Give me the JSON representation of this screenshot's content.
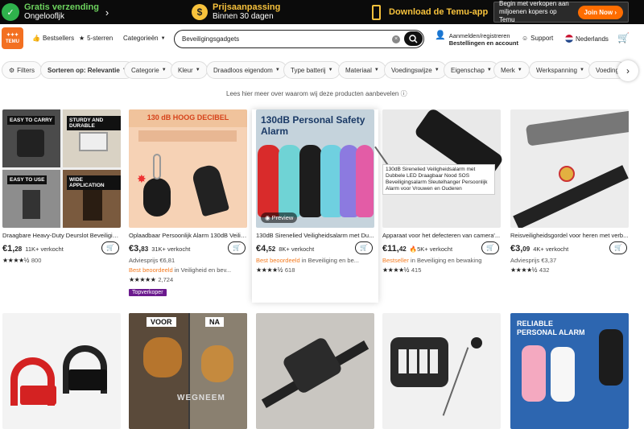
{
  "topbar": {
    "shipping_title": "Gratis verzending",
    "shipping_sub": "Ongeloofljk",
    "price_title": "Prijsaanpassing",
    "price_sub": "Binnen 30 dagen",
    "app": "Download de Temu-app",
    "seller_promo": "Begin met verkopen aan miljoenen kopers op Temu",
    "join": "Join Now"
  },
  "header": {
    "logo": "TEMU",
    "bestsellers": "Bestsellers",
    "five_star": "5-sterren",
    "categories": "Categorieën",
    "search_value": "Beveiligingsgadgets",
    "login_line1": "Aanmelden/registreren",
    "login_line2": "Bestellingen en account",
    "support": "Support",
    "language": "Nederlands"
  },
  "filters": [
    "Filters",
    "Sorteren op: Relevantie",
    "Categorie",
    "Kleur",
    "Draadloos eigendom",
    "Type batterij",
    "Materiaal",
    "Voedingswijze",
    "Eigenschap",
    "Merk",
    "Werkspanning",
    "Voeding"
  ],
  "note": "Lees hier meer over waarom wij deze producten aanbevelen",
  "products": [
    {
      "title": "Draagbare Heavy-Duty Deurslot Beveiligin...",
      "price_main": "€1,",
      "price_cents": "28",
      "sold": "11K+ verkocht",
      "rating_count": "800",
      "labels": [
        "EASY TO CARRY",
        "STURDY AND DURABLE",
        "EASY TO USE",
        "WIDE APPLICATION"
      ]
    },
    {
      "title": "Oplaadbaar Persoonlijk Alarm 130dB Veilig...",
      "price_main": "€3,",
      "price_cents": "83",
      "sold": "31K+ verkocht",
      "extra": "Adviesprijs €6,81",
      "best": "Best beoordeeld",
      "best_rest": "in Veiligheid en bev...",
      "rating_count": "2,724",
      "badge": "Topverkoper",
      "headline": "130 dB HOOG DECIBEL"
    },
    {
      "title": "130dB Sirenelied Veiligheidsalarm met Du...",
      "price_main": "€4,",
      "price_cents": "52",
      "sold": "8K+ verkocht",
      "best": "Best beoordeeld",
      "best_rest": "in Beveiliging en be...",
      "rating_count": "618",
      "headline": "130dB Personal Safety Alarm",
      "preview": "Preview"
    },
    {
      "title": "Apparaat voor het defecteren van camera'...",
      "price_main": "€11,",
      "price_cents": "42",
      "sold": "5K+ verkocht",
      "best": "Bestseller",
      "best_rest": "in Beveiliging en bewaking",
      "rating_count": "415",
      "tooltip": "130dB Sirenelied Veiligheidsalarm met Dubbele LED Draagbaar Nood SOS Beveiligingsalarm Sleutelhanger Persoonlijk Alarm voor Vrouwen en Ouderen"
    },
    {
      "title": "Reisveiligheidsgordel voor heren met verb...",
      "price_main": "€3,",
      "price_cents": "09",
      "sold": "4K+ verkocht",
      "extra": "Adviesprijs €3,37",
      "rating_count": "432"
    }
  ],
  "row2": {
    "voor": "VOOR",
    "na": "NA",
    "weg": "WEGNEEM",
    "reliable": "RELIABLE",
    "personal_alarm": "PERSONAL ALARM"
  },
  "colors": {
    "topbar_bg": "#0b0b0b",
    "accent": "#f37021",
    "green": "#6dd35e",
    "gold": "#f7c23c"
  }
}
